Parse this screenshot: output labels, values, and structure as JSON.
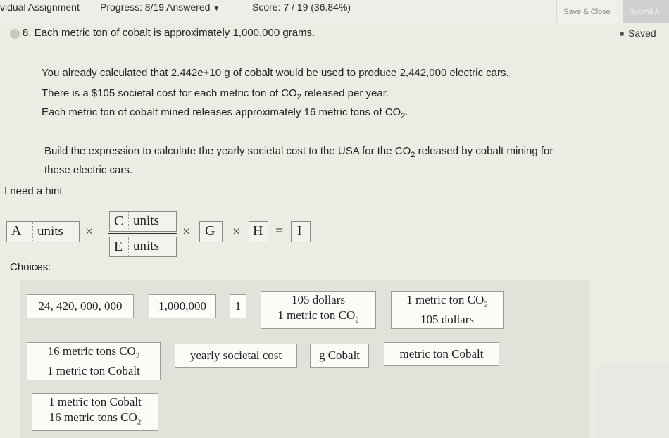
{
  "header": {
    "assignment": "vidual Assignment",
    "progress": "Progress: 8/19 Answered",
    "progress_caret": "▼",
    "score": "Score: 7 / 19 (36.84%)",
    "save_close": "Save & Close",
    "submit": "Submit A"
  },
  "question": {
    "number_text": "8. Each metric ton of cobalt is approximately 1,000,000 grams.",
    "saved_label": "Saved",
    "line1": "You already calculated that 2.442e+10 g of cobalt would be used to produce 2,442,000 electric cars.",
    "line2_a": "There is a $105 societal cost for each metric ton of CO",
    "line2_b": " released per year.",
    "line3_a": "Each metric ton of cobalt mined releases approximately 16 metric tons of CO",
    "line3_b": ".",
    "line4_a": "Build the expression to calculate the yearly societal cost to the USA for the CO",
    "line4_b": " released by cobalt mining for",
    "line5": "these electric cars.",
    "sub2": "2",
    "hint": "I need a hint"
  },
  "expression": {
    "A": "A",
    "units": "units",
    "times": "×",
    "C": "C",
    "E": "E",
    "G": "G",
    "H": "H",
    "I": "I",
    "equals": "="
  },
  "choices_label": "Choices:",
  "choices": {
    "c1": "24, 420, 000, 000",
    "c2": "1,000,000",
    "c3": "1",
    "c4_num": "105 dollars",
    "c4_den_a": "1 metric ton CO",
    "c5_num_a": "1 metric ton CO",
    "c5_den": "105 dollars",
    "c6_num_a": "16 metric tons CO",
    "c6_den": "1 metric ton Cobalt",
    "c7": "yearly societal cost",
    "c8": "g Cobalt",
    "c9": "metric ton Cobalt",
    "c10_num": "1 metric ton Cobalt",
    "c10_den_a": "16 metric tons CO",
    "sub2": "2"
  }
}
